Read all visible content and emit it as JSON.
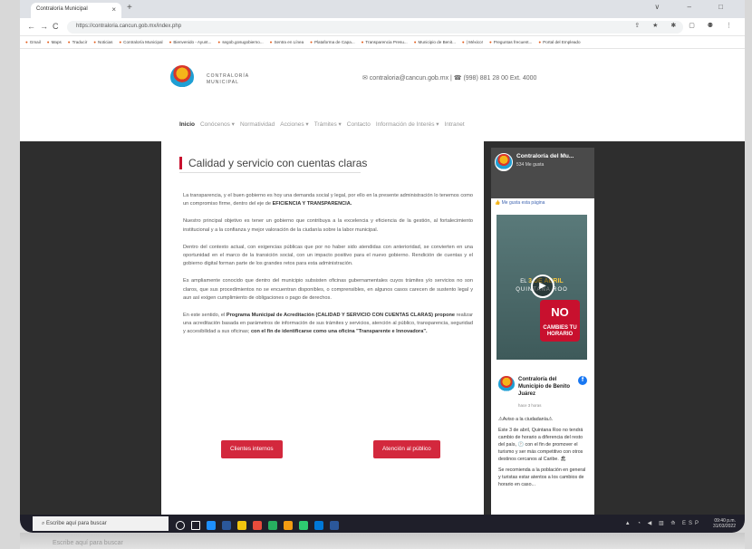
{
  "browser": {
    "tab_title": "Contraloría Municipal",
    "tab_close": "×",
    "new_tab": "+",
    "window_controls": "∨ – □",
    "nav": {
      "back": "←",
      "forward": "→",
      "reload": "C"
    },
    "url": "https://contraloria.cancun.gob.mx/index.php",
    "address_icons": "⇪ ★ ✱ ▢ ⚉ ⋮"
  },
  "bookmarks": [
    "Gmail",
    "Maps",
    "Traducir",
    "Noticias",
    "Contraloría Municipal",
    "Bienvenido - Ayunt...",
    "segob.gosugobierno...",
    "Sentra en Línea",
    "Plataforma de Capa...",
    "Transparencia Presu...",
    "Municipio de Benit...",
    "| México!",
    "Preguntas frecuent...",
    "Portal del Empleado"
  ],
  "header": {
    "logo_text_line1": "CONTRALORÍA",
    "logo_text_line2": "MUNICIPAL",
    "contact": "✉ contraloria@cancun.gob.mx | ☎ (998) 881 28 00 Ext. 4000"
  },
  "nav_menu": [
    {
      "label": "Inicio",
      "active": true
    },
    {
      "label": "Conócenos ▾"
    },
    {
      "label": "Normatividad"
    },
    {
      "label": "Acciones ▾"
    },
    {
      "label": "Trámites ▾"
    },
    {
      "label": "Contacto"
    },
    {
      "label": "Información de Interés ▾"
    },
    {
      "label": "Intranet"
    }
  ],
  "article": {
    "title": "Calidad y servicio con cuentas claras",
    "p1_a": "La transparencia, y el buen gobierno es hoy una demanda social y legal, por ello en la presente administración lo tenemos como un compromiso firme, dentro del eje de ",
    "p1_b": "EFICIENCIA Y TRANSPARENCIA.",
    "p2": "Nuestro principal objetivo es tener un gobierno que contribuya a la excelencia y eficiencia de la gestión, al fortalecimiento institucional y a la confianza y mejor valoración de la ciudanía sobre la labor municipal.",
    "p3": "Dentro del contexto actual, con exigencias públicas que por no haber sido atendidas con anterioridad, se convierten en una oportunidad en el marco de la transición social, con un impacto positivo para el nuevo gobierno. Rendición de cuentas y el gobierno digital forman parte de los grandes retos para esta administración.",
    "p4": "Es ampliamente conocido que dentro del municipio subsisten oficinas gubernamentales cuyos trámites y/o servicios no son claros, que sus procedimientos no se encuentran disponibles, o comprensibles, en algunos casos carecen de sustento legal y aun así exigen cumplimiento de obligaciones o pago de derechos.",
    "p5_a": "En este sentido, el ",
    "p5_b": "Programa Municipal de Acreditación (CALIDAD Y SERVICIO CON CUENTAS CLARAS) propone",
    "p5_c": " realizar una acreditación basada en parámetros de información de sus trámites y servicios, atención al público, transparencia, seguridad y accesibilidad a sus oficinas; ",
    "p5_d": "con el fin de identificarse como una oficina \"Transparente e Innovadora\".",
    "button_internos": "Clientes internos",
    "button_publico": "Atención al público"
  },
  "facebook": {
    "page_name": "Contraloría del Mu...",
    "likes": "534 Me gusta",
    "like_button": "Me gusta esta página",
    "poster_date_prefix": "EL ",
    "poster_date": "3 DE ABRIL",
    "poster_state": "QUINTANA ROO",
    "poster_sign": "NO",
    "poster_sign_sub": "CAMBIES TU HORARIO",
    "play_icon": "▶",
    "author": "Contraloría del Municipio de Benito Juárez",
    "time": "hace 3 horas",
    "post_p1": "⚠Aviso a la ciudadanía⚠",
    "post_p2": "Este 3 de abril, Quintana Roo no tendrá cambio de horario a diferencia del resto del país, 🕐 con el fin de promover el turismo y ser más competitivo con otros destinos cercanos al Caribe. 🏖",
    "post_p3": "Se recomienda a la población en general y turistas estar atentos a los cambios de horario en caso..."
  },
  "taskbar": {
    "search_placeholder": "Escribe aquí para buscar",
    "tray_icons": "▲ ◔ ◀ ▥ ⟰ ESP",
    "time": "09:40 p.m.",
    "date": "31/03/2022",
    "icon_colors": [
      "#ffffff",
      "#ffffff",
      "#1e90ff",
      "#2b579a",
      "#f1c40f",
      "#e74c3c",
      "#27ae60",
      "#f39c12",
      "#2ecc71",
      "#0078d7",
      "#2b579a"
    ]
  },
  "reflection": "Escribe aquí para buscar"
}
